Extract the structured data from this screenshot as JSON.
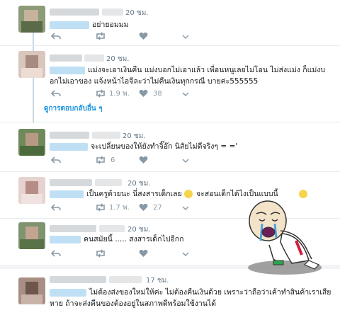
{
  "tweets": [
    {
      "time": "20 ชม.",
      "text": [
        "อย่ายอมมม"
      ],
      "retweets": "",
      "likes": ""
    },
    {
      "time": "20 ชม.",
      "text": [
        "แม่งจะเอาเงินคืน แม่งบอกไม่เอาแล้ว เพื่อนหนูเลยไม่โอน ไม่ส่งแม่ง ก็แม่งบ",
        "อกไม่เอาของ แจ้งหน้าไอจีละว่าไม่คืนเงินทุกกรณี บายค่ะ555555"
      ],
      "retweets": "1.9 พ.",
      "likes": "38"
    },
    {
      "time": "20 ชม.",
      "text": [
        "จะเปลี่ยนของให้ยังทำจิ๊อ๊ก นิสัยไม่ดีจริงๆ = ='"
      ],
      "retweets": "6",
      "likes": ""
    },
    {
      "time": "20 ชม.",
      "text": [
        "เป็นครูด้วยนะ นี่สงสารเด็กเลย",
        "จะสอนเด็กได้ไงเป็นแบบนี้"
      ],
      "retweets": "1.7 พ.",
      "likes": "27"
    },
    {
      "time": "20 ชม.",
      "text": [
        "คนสมัยนี้ ..... สงสารเด็กไปอีกก"
      ],
      "retweets": "",
      "likes": ""
    },
    {
      "time": "17 ชม.",
      "text": [
        "ไม่ต้องส่งของใหม่ให้ค่ะ ไม่ต้องคืนเงินด้วย เพราะว่าถือว่าเค้าทำสินค้าเราเสีย",
        "หาย ถ้าจะส่งคืนของต้องอยู่ในสภาพดีพร้อมใช้งานได้"
      ],
      "retweets": "",
      "likes": ""
    }
  ],
  "more_replies": "ดูการตอบกลับอื่น ๆ",
  "icons": {
    "reply": "reply-icon",
    "retweet": "retweet-icon",
    "like": "heart-icon",
    "more": "more-icon"
  },
  "colors": {
    "link": "#1b95e0",
    "muted": "#8899a6",
    "thread": "#c8d9e6"
  }
}
